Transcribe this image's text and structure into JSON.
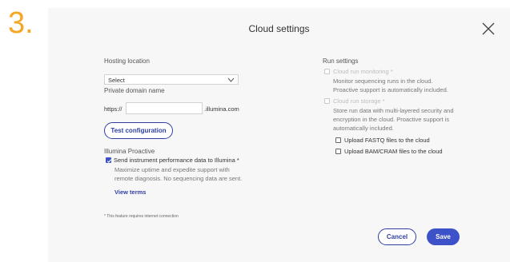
{
  "step_number": "3.",
  "dialog": {
    "title": "Cloud settings"
  },
  "hosting": {
    "label": "Hosting location",
    "selected_value": "Select"
  },
  "domain": {
    "label": "Private domain name",
    "prefix": "https://",
    "value": "",
    "suffix": ".illumina.com"
  },
  "test_configuration_label": "Test configuration",
  "proactive": {
    "label": "Illumina Proactive",
    "checkbox_label": "Send instrument performance data to Illumina *",
    "checked": true,
    "description_line1": "Maximize uptime and expedite support with",
    "description_line2": "remote diagnosis. No sequencing data are sent.",
    "view_terms_label": "View terms"
  },
  "footnote": "* This feature requires internet connection",
  "run_settings": {
    "label": "Run settings",
    "monitoring": {
      "label": "Cloud run monitoring *",
      "description_line1": "Monitor sequencing runs in the cloud.",
      "description_line2": "Proactive support is automatically included."
    },
    "storage": {
      "label": "Cloud run storage *",
      "description_line1": "Store run data with multi-layered security and",
      "description_line2": "encryption in the cloud. Proactive support is",
      "description_line3": "automatically included.",
      "upload_fastq_label": "Upload FASTQ files to the cloud",
      "upload_bam_label": "Upload BAM/CRAM files to the cloud"
    }
  },
  "buttons": {
    "cancel": "Cancel",
    "save": "Save"
  },
  "colors": {
    "step_number": "#f5a623",
    "accent": "#3d52c9",
    "outline_button": "#2f3fa3",
    "dialog_background": "#f7f7f7"
  },
  "icons": {
    "close": "close-icon",
    "dropdown": "chevron-down-icon",
    "check": "checkmark-icon"
  }
}
